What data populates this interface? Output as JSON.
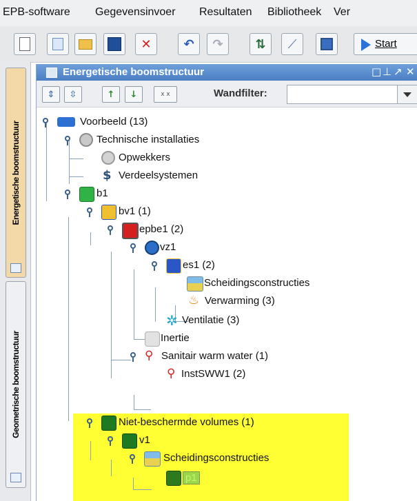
{
  "menubar": {
    "items": [
      "EPB-software",
      "Gegevensinvoer",
      "Resultaten",
      "Bibliotheek",
      "Ver"
    ]
  },
  "toolbar": {
    "buttons": [
      "new-icon",
      "document-icon",
      "open-folder-icon",
      "save-icon",
      "delete-icon",
      "undo-icon",
      "redo-icon",
      "refresh-icon",
      "tool-icon",
      "frame-icon"
    ],
    "start_label": "Start"
  },
  "side_tabs": {
    "energy": "Energetische boomstructuur",
    "geometry": "Geometrische boomstructuur"
  },
  "panel": {
    "title": "Energetische boomstructuur",
    "controls": [
      "□",
      "⊥",
      "↗",
      "✕"
    ]
  },
  "filterbar": {
    "label": "Wandfilter:",
    "value": ""
  },
  "tree": [
    {
      "label": "Voorbeeld (13)",
      "icon": "people-icon",
      "color": "#2d6fd3"
    },
    {
      "label": "Technische installaties",
      "icon": "gears-icon",
      "color": "#9a9a9a"
    },
    {
      "label": "Opwekkers",
      "icon": "gear-icon",
      "color": "#a8a8a8"
    },
    {
      "label": "Verdeelsystemen",
      "icon": "dollar-icon",
      "color": "#2a4f7a"
    },
    {
      "label": "b1",
      "icon": "green-cube-icon",
      "color": "#27a33b"
    },
    {
      "label": "bv1 (1)",
      "icon": "yellow-cube-icon",
      "color": "#e4b51f"
    },
    {
      "label": "epbe1 (2)",
      "icon": "red-cube-icon",
      "color": "#d42020"
    },
    {
      "label": "vz1",
      "icon": "zone-icon",
      "color": "#2a6ec7"
    },
    {
      "label": "es1 (2)",
      "icon": "energy-sector-icon",
      "color": "#2a56c7"
    },
    {
      "label": "Scheidingsconstructies",
      "icon": "construction-icon",
      "color": "#e2c83b"
    },
    {
      "label": "Verwarming (3)",
      "icon": "flame-icon",
      "color": "#f08a1a"
    },
    {
      "label": "Ventilatie (3)",
      "icon": "fan-icon",
      "color": "#21a7c7"
    },
    {
      "label": "Inertie",
      "icon": "inertia-icon",
      "color": "#c8c8c8"
    },
    {
      "label": "Sanitair warm water (1)",
      "icon": "tap-icon",
      "color": "#2a5bc7"
    },
    {
      "label": "InstSWW1 (2)",
      "icon": "tap-icon",
      "color": "#2a5bc7"
    },
    {
      "label": "Niet-beschermde volumes (1)",
      "icon": "dark-green-cube-icon",
      "color": "#1e7a22"
    },
    {
      "label": "v1",
      "icon": "dark-green-cube-icon",
      "color": "#1e7a22"
    },
    {
      "label": "Scheidingsconstructies",
      "icon": "construction-icon",
      "color": "#e2c83b"
    },
    {
      "label": "p1",
      "icon": "panel-icon",
      "color": "#3e8d2a"
    }
  ]
}
